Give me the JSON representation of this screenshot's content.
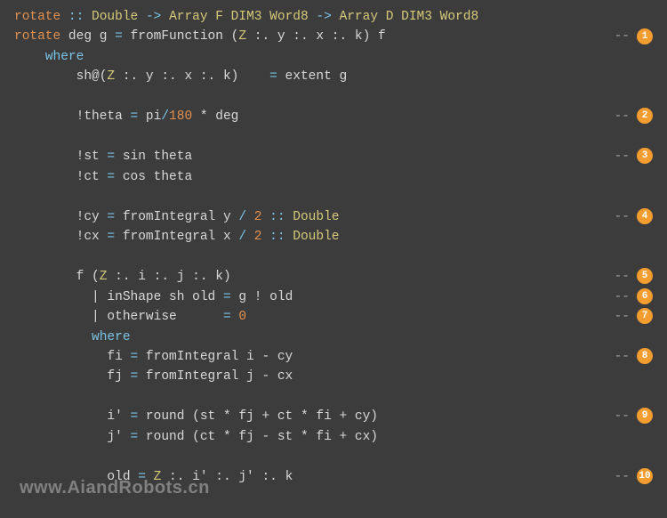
{
  "code": {
    "lines": [
      {
        "html": "<span class='def'>rotate</span> <span class='kw'>::</span> <span class='const'>Double</span> <span class='kw'>-&gt;</span> <span class='const'>Array F DIM3 Word8</span> <span class='kw'>-&gt;</span> <span class='const'>Array D DIM3 Word8</span>"
      },
      {
        "html": "<span class='def'>rotate</span> deg g <span class='kw'>=</span> fromFunction (<span class='const'>Z</span> :. y :. x :. k) f",
        "callout": "1"
      },
      {
        "html": "    <span class='kw'>where</span>"
      },
      {
        "html": "        sh@(<span class='const'>Z</span> :. y :. x :. k)    <span class='kw'>=</span> extent g"
      },
      {
        "html": " "
      },
      {
        "html": "        !theta <span class='kw'>=</span> pi<span class='kw'>/</span><span class='num'>180</span> * deg",
        "callout": "2"
      },
      {
        "html": " "
      },
      {
        "html": "        !st <span class='kw'>=</span> sin theta",
        "callout": "3"
      },
      {
        "html": "        !ct <span class='kw'>=</span> cos theta"
      },
      {
        "html": " "
      },
      {
        "html": "        !cy <span class='kw'>=</span> fromIntegral y <span class='kw'>/</span> <span class='num'>2</span> <span class='kw'>::</span> <span class='const'>Double</span>",
        "callout": "4"
      },
      {
        "html": "        !cx <span class='kw'>=</span> fromIntegral x <span class='kw'>/</span> <span class='num'>2</span> <span class='kw'>::</span> <span class='const'>Double</span>"
      },
      {
        "html": " "
      },
      {
        "html": "        f (<span class='const'>Z</span> :. i :. j :. k)",
        "callout": "5"
      },
      {
        "html": "          | inShape sh old <span class='kw'>=</span> g ! old",
        "callout": "6"
      },
      {
        "html": "          | otherwise      <span class='kw'>=</span> <span class='num'>0</span>",
        "callout": "7"
      },
      {
        "html": "          <span class='kw'>where</span>"
      },
      {
        "html": "            fi <span class='kw'>=</span> fromIntegral i - cy",
        "callout": "8"
      },
      {
        "html": "            fj <span class='kw'>=</span> fromIntegral j - cx"
      },
      {
        "html": " "
      },
      {
        "html": "            i' <span class='kw'>=</span> round (st * fj + ct * fi + cy)",
        "callout": "9"
      },
      {
        "html": "            j' <span class='kw'>=</span> round (ct * fj - st * fi + cx)"
      },
      {
        "html": " "
      },
      {
        "html": "            old <span class='kw'>=</span> <span class='const'>Z</span> :. i' :. j' :. k",
        "callout": "10"
      }
    ],
    "dash": "--"
  },
  "watermark": "www.AiandRobots.cn"
}
